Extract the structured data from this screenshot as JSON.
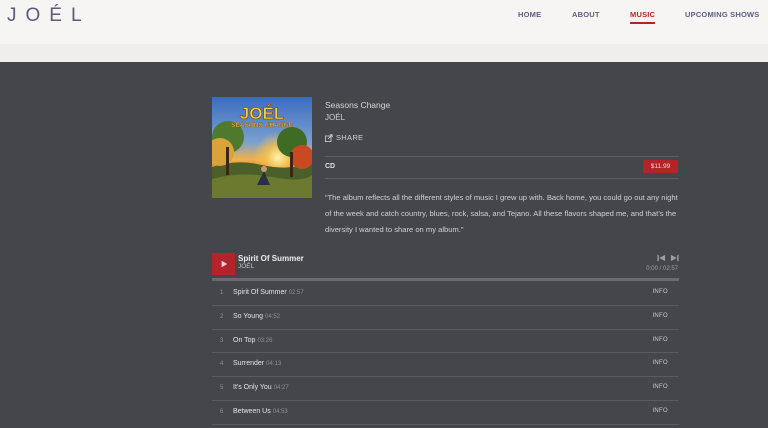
{
  "site": {
    "logo": "JOÉL"
  },
  "nav": {
    "items": [
      {
        "label": "HOME",
        "active": false
      },
      {
        "label": "ABOUT",
        "active": false
      },
      {
        "label": "MUSIC",
        "active": true
      },
      {
        "label": "UPCOMING SHOWS",
        "active": false
      }
    ]
  },
  "album": {
    "cover_icon": "album-cover-image",
    "cover_text_artist": "JOÉL",
    "cover_text_title": "SEASONS CHANGE",
    "title": "Seasons Change",
    "artist": "JOÉL",
    "share_label": "SHARE",
    "format_label": "CD",
    "price": "$11.99",
    "description": "“The album reflects all the different styles of music I grew up with. Back home, you could go out any night of the week and catch country, blues, rock, salsa, and Tejano. All these flavors shaped me, and that’s the diversity I wanted to share on my album.”"
  },
  "player": {
    "now_playing_title": "Spirit Of Summer",
    "now_playing_artist": "JOÉL",
    "time": "0:00 / 02:57",
    "progress": 0
  },
  "tracks": [
    {
      "num": "1",
      "name": "Spirit Of Summer",
      "duration": "02:57",
      "info": "INFO"
    },
    {
      "num": "2",
      "name": "So Young",
      "duration": "04:52",
      "info": "INFO"
    },
    {
      "num": "3",
      "name": "On Top",
      "duration": "03:26",
      "info": "INFO"
    },
    {
      "num": "4",
      "name": "Surrender",
      "duration": "04:13",
      "info": "INFO"
    },
    {
      "num": "5",
      "name": "It's Only You",
      "duration": "04:27",
      "info": "INFO"
    },
    {
      "num": "6",
      "name": "Between Us",
      "duration": "04:53",
      "info": "INFO"
    }
  ],
  "colors": {
    "accent": "#b3232a",
    "background": "#45464b",
    "header": "#f6f5f4",
    "nav": "#5b5f7c"
  }
}
